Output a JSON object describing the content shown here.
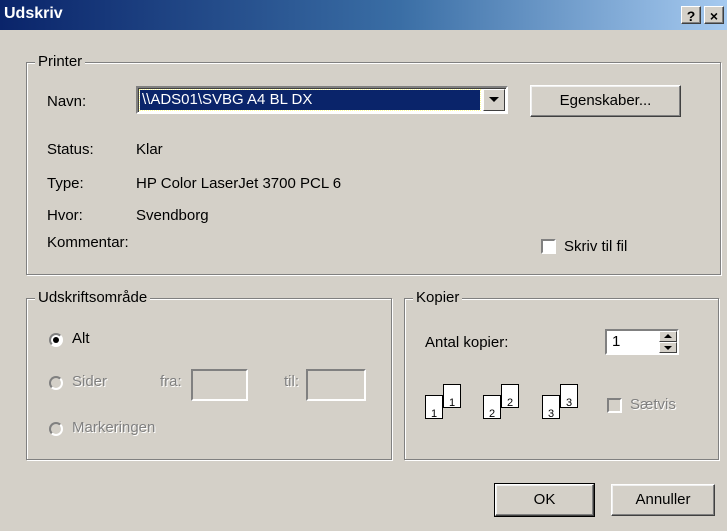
{
  "window": {
    "title": "Udskriv",
    "help_glyph": "?",
    "close_glyph": "×"
  },
  "printer": {
    "legend": "Printer",
    "name_label": "Navn:",
    "name_value": "\\\\ADS01\\SVBG A4 BL DX",
    "properties_button": "Egenskaber...",
    "status_label": "Status:",
    "status_value": "Klar",
    "type_label": "Type:",
    "type_value": "HP Color LaserJet 3700 PCL 6",
    "where_label": "Hvor:",
    "where_value": "Svendborg",
    "comment_label": "Kommentar:",
    "print_to_file_label": "Skriv til fil"
  },
  "range": {
    "legend": "Udskriftsområde",
    "all_label": "Alt",
    "pages_label": "Sider",
    "from_label": "fra:",
    "to_label": "til:",
    "from_value": "",
    "to_value": "",
    "selection_label": "Markeringen",
    "selected": "all"
  },
  "copies": {
    "legend": "Kopier",
    "count_label": "Antal kopier:",
    "count_value": "1",
    "collate_label": "Sætvis",
    "collate_checked": false,
    "collate_enabled": false,
    "page_numbers": [
      "1",
      "1",
      "2",
      "2",
      "3",
      "3"
    ]
  },
  "footer": {
    "ok_button": "OK",
    "cancel_button": "Annuller"
  },
  "colors": {
    "face": "#d4d0c8",
    "selection": "#0a246a",
    "title_start": "#0a246a",
    "title_end": "#a6caf0"
  }
}
